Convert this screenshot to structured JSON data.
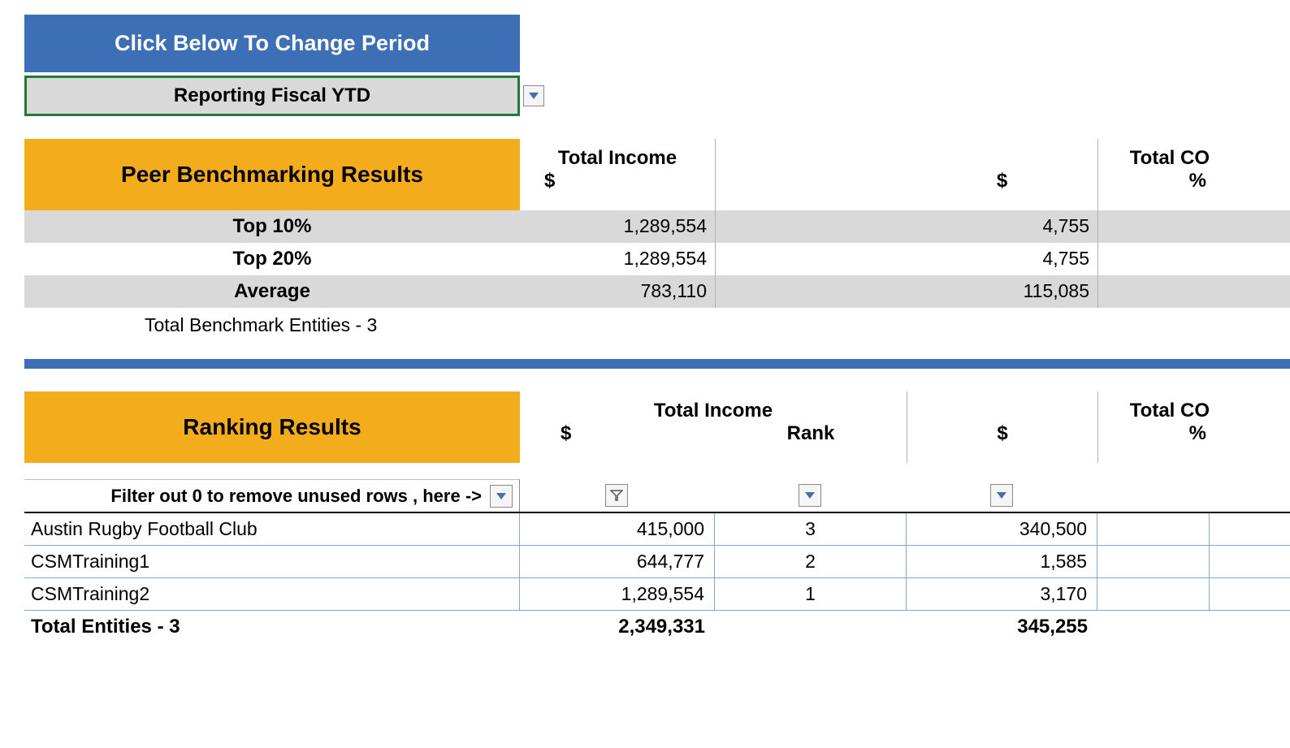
{
  "period": {
    "title": "Click Below To Change Period",
    "selected": "Reporting Fiscal YTD"
  },
  "benchmark": {
    "heading": "Peer Benchmarking Results",
    "col_income": "Total Income",
    "col_co": "Total CO",
    "sub_dollar": "$",
    "sub_pct": "%",
    "rows": [
      {
        "label": "Top 10%",
        "income": "1,289,554",
        "co": "4,755"
      },
      {
        "label": "Top 20%",
        "income": "1,289,554",
        "co": "4,755"
      },
      {
        "label": "Average",
        "income": "783,110",
        "co": "115,085"
      }
    ],
    "entities_note": "Total Benchmark Entities - 3"
  },
  "ranking": {
    "heading": "Ranking Results",
    "col_income": "Total Income",
    "col_co": "Total CO",
    "sub_dollar": "$",
    "sub_rank": "Rank",
    "sub_pct": "%",
    "filter_hint": "Filter out 0 to remove unused rows , here ->",
    "rows": [
      {
        "name": "Austin Rugby Football Club",
        "income": "415,000",
        "rank": "3",
        "co": "340,500"
      },
      {
        "name": "CSMTraining1",
        "income": "644,777",
        "rank": "2",
        "co": "1,585"
      },
      {
        "name": "CSMTraining2",
        "income": "1,289,554",
        "rank": "1",
        "co": "3,170"
      }
    ],
    "total_label": "Total Entities - 3",
    "total_income": "2,349,331",
    "total_co": "345,255"
  }
}
